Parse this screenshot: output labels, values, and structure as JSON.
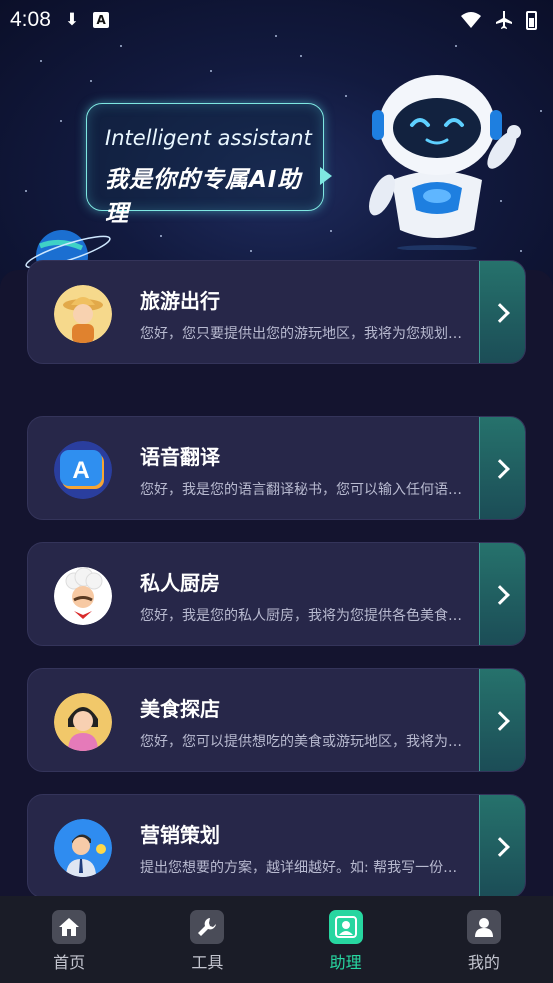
{
  "status_bar": {
    "time": "4:08"
  },
  "hero": {
    "en": "Intelligent assistant",
    "cn": "我是你的专属AI助理"
  },
  "cards": [
    {
      "title": "旅游出行",
      "desc": "您好，您只要提供出您的游玩地区，我将为您规划行程…",
      "icon": "traveler-avatar-icon"
    },
    {
      "title": "语音翻译",
      "desc": "您好，我是您的语言翻译秘书，您可以输入任何语言…",
      "icon": "translate-a-icon"
    },
    {
      "title": "私人厨房",
      "desc": "您好，我是您的私人厨房，我将为您提供各色美食做法…",
      "icon": "chef-avatar-icon"
    },
    {
      "title": "美食探店",
      "desc": "您好，您可以提供想吃的美食或游玩地区，我将为您推荐…",
      "icon": "foodie-avatar-icon"
    },
    {
      "title": "营销策划",
      "desc": "提出您想要的方案，越详细越好。如: 帮我写一份营销方案…",
      "icon": "marketer-avatar-icon"
    }
  ],
  "tabbar": {
    "items": [
      {
        "label": "首页",
        "icon": "home-icon"
      },
      {
        "label": "工具",
        "icon": "wrench-icon"
      },
      {
        "label": "助理",
        "icon": "assistant-icon",
        "active": true
      },
      {
        "label": "我的",
        "icon": "profile-icon"
      }
    ]
  },
  "colors": {
    "accent": "#27d6a0",
    "card_bg": "#272749",
    "page_bg": "#14142f"
  }
}
